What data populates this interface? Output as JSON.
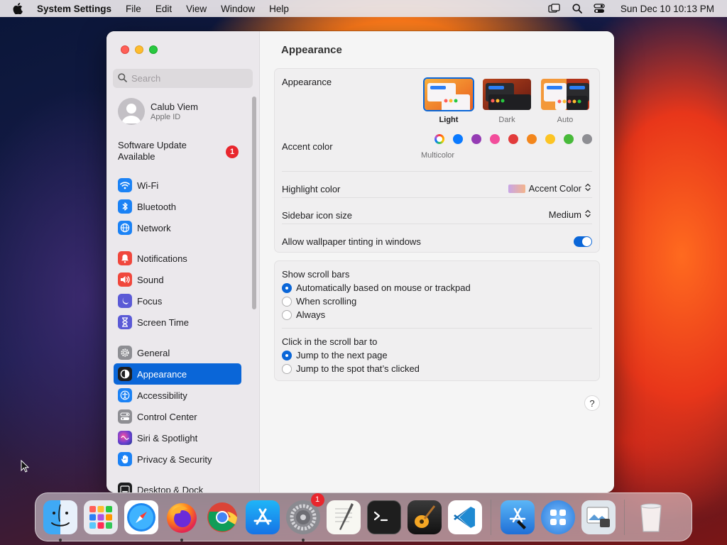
{
  "menubar": {
    "app_name": "System Settings",
    "items": [
      "File",
      "Edit",
      "View",
      "Window",
      "Help"
    ],
    "clock": "Sun Dec 10  10:13 PM"
  },
  "sidebar": {
    "search_placeholder": "Search",
    "account": {
      "name": "Calub Viem",
      "subtitle": "Apple ID"
    },
    "update": {
      "label": "Software Update Available",
      "count": "1"
    },
    "groups": [
      [
        {
          "id": "wifi",
          "label": "Wi-Fi",
          "icon": "wifi-icon",
          "color": "#1b82f5"
        },
        {
          "id": "bluetooth",
          "label": "Bluetooth",
          "icon": "bluetooth-icon",
          "color": "#1b82f5"
        },
        {
          "id": "network",
          "label": "Network",
          "icon": "globe-icon",
          "color": "#1b82f5"
        }
      ],
      [
        {
          "id": "notifications",
          "label": "Notifications",
          "icon": "bell-icon",
          "color": "#f0473c"
        },
        {
          "id": "sound",
          "label": "Sound",
          "icon": "speaker-icon",
          "color": "#f0473c"
        },
        {
          "id": "focus",
          "label": "Focus",
          "icon": "moon-icon",
          "color": "#5b5ad6"
        },
        {
          "id": "screen-time",
          "label": "Screen Time",
          "icon": "hourglass-icon",
          "color": "#5b5ad6"
        }
      ],
      [
        {
          "id": "general",
          "label": "General",
          "icon": "gear-icon",
          "color": "#8e8e93"
        },
        {
          "id": "appearance",
          "label": "Appearance",
          "icon": "appearance-icon",
          "color": "#1d1d1f",
          "selected": true
        },
        {
          "id": "accessibility",
          "label": "Accessibility",
          "icon": "accessibility-icon",
          "color": "#1b82f5"
        },
        {
          "id": "control-center",
          "label": "Control Center",
          "icon": "control-center-icon",
          "color": "#8e8e93"
        },
        {
          "id": "siri",
          "label": "Siri & Spotlight",
          "icon": "siri-icon",
          "color": "#6b3fd1"
        },
        {
          "id": "privacy",
          "label": "Privacy & Security",
          "icon": "hand-icon",
          "color": "#1b82f5"
        }
      ],
      [
        {
          "id": "desktop-dock",
          "label": "Desktop & Dock",
          "icon": "dock-icon",
          "color": "#1d1d1f"
        }
      ]
    ]
  },
  "content": {
    "title": "Appearance",
    "appearance": {
      "label": "Appearance",
      "options": [
        {
          "id": "light",
          "label": "Light",
          "selected": true
        },
        {
          "id": "dark",
          "label": "Dark",
          "selected": false
        },
        {
          "id": "auto",
          "label": "Auto",
          "selected": false
        }
      ]
    },
    "accent": {
      "label": "Accent color",
      "caption": "Multicolor",
      "colors": [
        "multicolor",
        "#0a7aff",
        "#953cb4",
        "#f24d9b",
        "#e23b3b",
        "#f3861c",
        "#fcc424",
        "#48ba3a",
        "#8e8e93"
      ],
      "selected": "multicolor"
    },
    "highlight": {
      "label": "Highlight color",
      "value": "Accent Color"
    },
    "icon_size": {
      "label": "Sidebar icon size",
      "value": "Medium"
    },
    "tinting": {
      "label": "Allow wallpaper tinting in windows",
      "on": true
    },
    "scroll_bars": {
      "label": "Show scroll bars",
      "options": [
        {
          "label": "Automatically based on mouse or trackpad",
          "checked": true
        },
        {
          "label": "When scrolling",
          "checked": false
        },
        {
          "label": "Always",
          "checked": false
        }
      ]
    },
    "click_scroll": {
      "label": "Click in the scroll bar to",
      "options": [
        {
          "label": "Jump to the next page",
          "checked": true
        },
        {
          "label": "Jump to the spot that’s clicked",
          "checked": false
        }
      ]
    },
    "help": "?"
  },
  "dock": {
    "apps": [
      {
        "name": "finder",
        "running": true
      },
      {
        "name": "launchpad",
        "running": false
      },
      {
        "name": "safari",
        "running": false
      },
      {
        "name": "firefox",
        "running": true
      },
      {
        "name": "chrome",
        "running": false
      },
      {
        "name": "app-store",
        "running": false
      },
      {
        "name": "system-settings",
        "running": true,
        "badge": "1"
      },
      {
        "name": "textedit",
        "running": false
      },
      {
        "name": "terminal",
        "running": false
      },
      {
        "name": "garageband",
        "running": false
      },
      {
        "name": "vscode",
        "running": false
      }
    ],
    "right_apps": [
      "xcode-installer",
      "grid-folder",
      "preview-folder"
    ],
    "trash": "trash"
  }
}
